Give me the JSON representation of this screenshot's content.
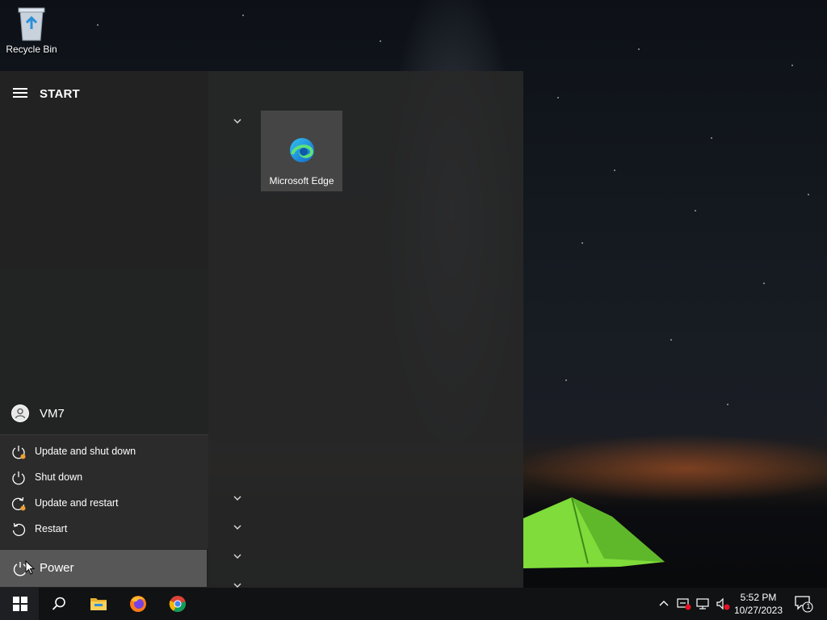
{
  "desktop": {
    "recycle_bin_label": "Recycle Bin"
  },
  "start_menu": {
    "title": "START",
    "user": {
      "name": "VM7"
    },
    "power_options": [
      {
        "label": "Update and shut down",
        "icon": "update-shutdown-icon"
      },
      {
        "label": "Shut down",
        "icon": "power-icon"
      },
      {
        "label": "Update and restart",
        "icon": "update-restart-icon"
      },
      {
        "label": "Restart",
        "icon": "restart-icon"
      }
    ],
    "power_button_label": "Power",
    "tiles": [
      {
        "label": "Microsoft Edge",
        "icon": "edge-icon"
      }
    ]
  },
  "taskbar": {
    "pinned": [
      "start-icon",
      "search-icon",
      "file-explorer-icon",
      "firefox-icon",
      "chrome-icon"
    ],
    "clock": {
      "time": "5:52 PM",
      "date": "10/27/2023"
    },
    "notification_count": "1"
  },
  "colors": {
    "accent_orange": "#f0a030",
    "edge_blue": "#1f8fe0",
    "tent_green": "#7fdc3a"
  }
}
